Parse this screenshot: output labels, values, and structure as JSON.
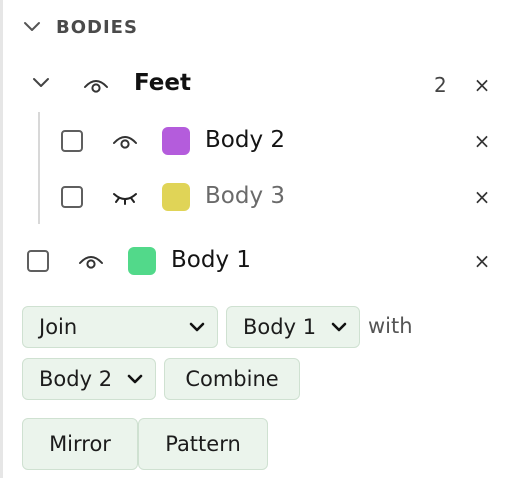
{
  "section": {
    "title": "BODIES",
    "icon": "chevron-down-icon"
  },
  "group": {
    "name": "Feet",
    "count": "2",
    "children": [
      {
        "name": "Body 2",
        "color": "#b45cdc",
        "visible": true
      },
      {
        "name": "Body 3",
        "color": "#e0d457",
        "visible": false
      }
    ]
  },
  "bodies": [
    {
      "name": "Body 1",
      "color": "#52d98a",
      "visible": true
    }
  ],
  "operation": {
    "selected": "Join",
    "target": "Body 1",
    "with_label": "with",
    "other": "Body 2",
    "combine_label": "Combine"
  },
  "actions": {
    "mirror_label": "Mirror",
    "pattern_label": "Pattern"
  },
  "close_symbol": "×"
}
